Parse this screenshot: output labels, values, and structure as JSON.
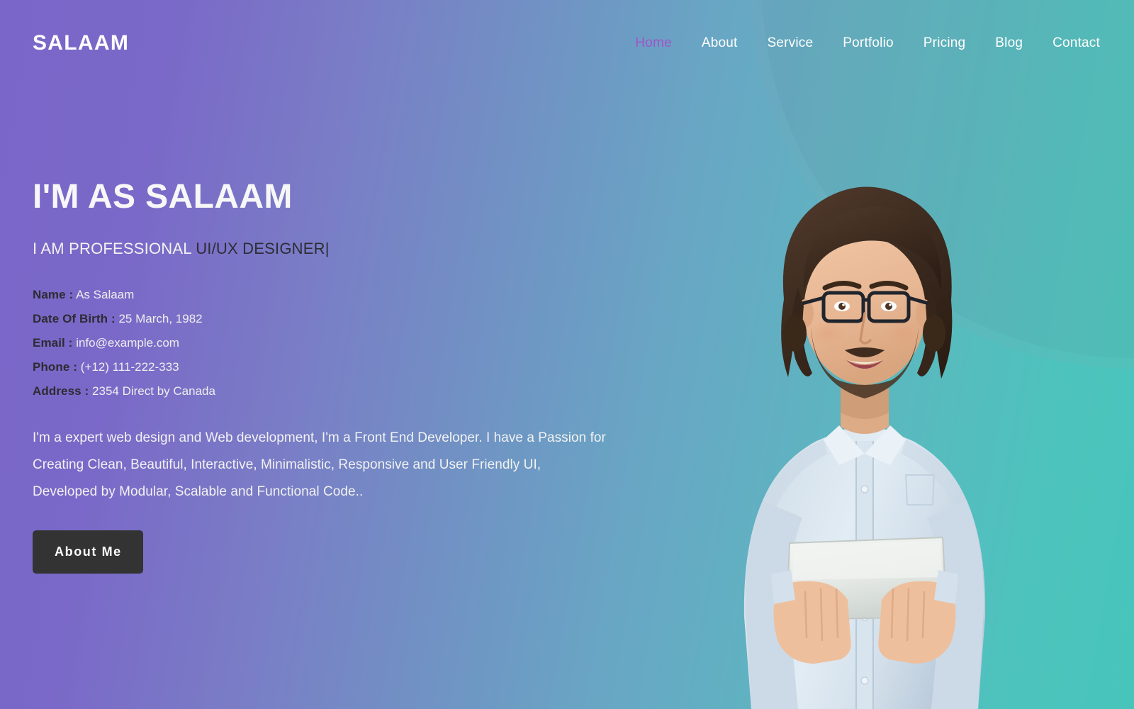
{
  "header": {
    "brand": "SALAAM",
    "nav": [
      {
        "label": "Home",
        "active": true
      },
      {
        "label": "About",
        "active": false
      },
      {
        "label": "Service",
        "active": false
      },
      {
        "label": "Portfolio",
        "active": false
      },
      {
        "label": "Pricing",
        "active": false
      },
      {
        "label": "Blog",
        "active": false
      },
      {
        "label": "Contact",
        "active": false
      }
    ]
  },
  "hero": {
    "title": "I'M AS SALAAM",
    "subtitle_static": "I AM PROFESSIONAL ",
    "subtitle_typed": "UI/UX DESIGNER",
    "typed_cursor": "|",
    "info": [
      {
        "label": "Name :",
        "value": "As Salaam"
      },
      {
        "label": "Date Of Birth :",
        "value": "25 March, 1982"
      },
      {
        "label": "Email :",
        "value": "info@example.com"
      },
      {
        "label": "Phone :",
        "value": "(+12) 111-222-333"
      },
      {
        "label": "Address :",
        "value": "2354 Direct by Canada"
      }
    ],
    "description": "I'm a expert web design and Web development, I'm a Front End Developer. I have a Passion for Creating Clean, Beautiful, Interactive, Minimalistic, Responsive and User Friendly UI, Developed by Modular, Scalable and Functional Code..",
    "cta_label": "About Me",
    "photo_alt": "portrait-man-with-glasses-holding-tablet"
  },
  "colors": {
    "gradient_start": "#7a66c9",
    "gradient_end": "#47c5bb",
    "active_nav": "#a055c8",
    "button_bg": "#333333",
    "label_text": "#2c2c32",
    "body_text": "#f2f2f2"
  }
}
